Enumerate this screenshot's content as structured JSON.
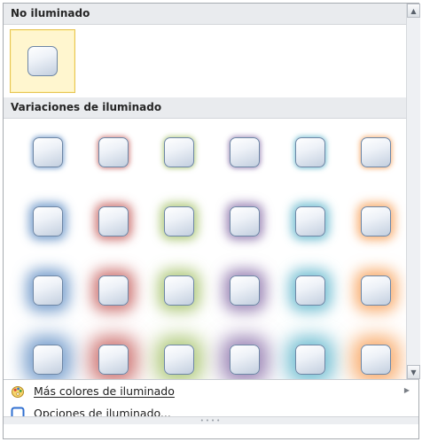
{
  "sections": {
    "no_glow_title": "No iluminado",
    "variations_title": "Variaciones de iluminado"
  },
  "glow_colors": [
    "#4f81bd",
    "#c0504d",
    "#9bbb59",
    "#8064a2",
    "#4bacc6",
    "#f79646"
  ],
  "glow_levels": 4,
  "menu": {
    "more_colors": "Más colores de iluminado",
    "options": "Opciones de iluminado..."
  },
  "icons": {
    "scroll_up": "scroll-up-arrow-icon",
    "scroll_down": "scroll-down-arrow-icon",
    "more_colors": "color-palette-icon",
    "options": "glow-options-icon",
    "submenu": "submenu-arrow-icon"
  }
}
